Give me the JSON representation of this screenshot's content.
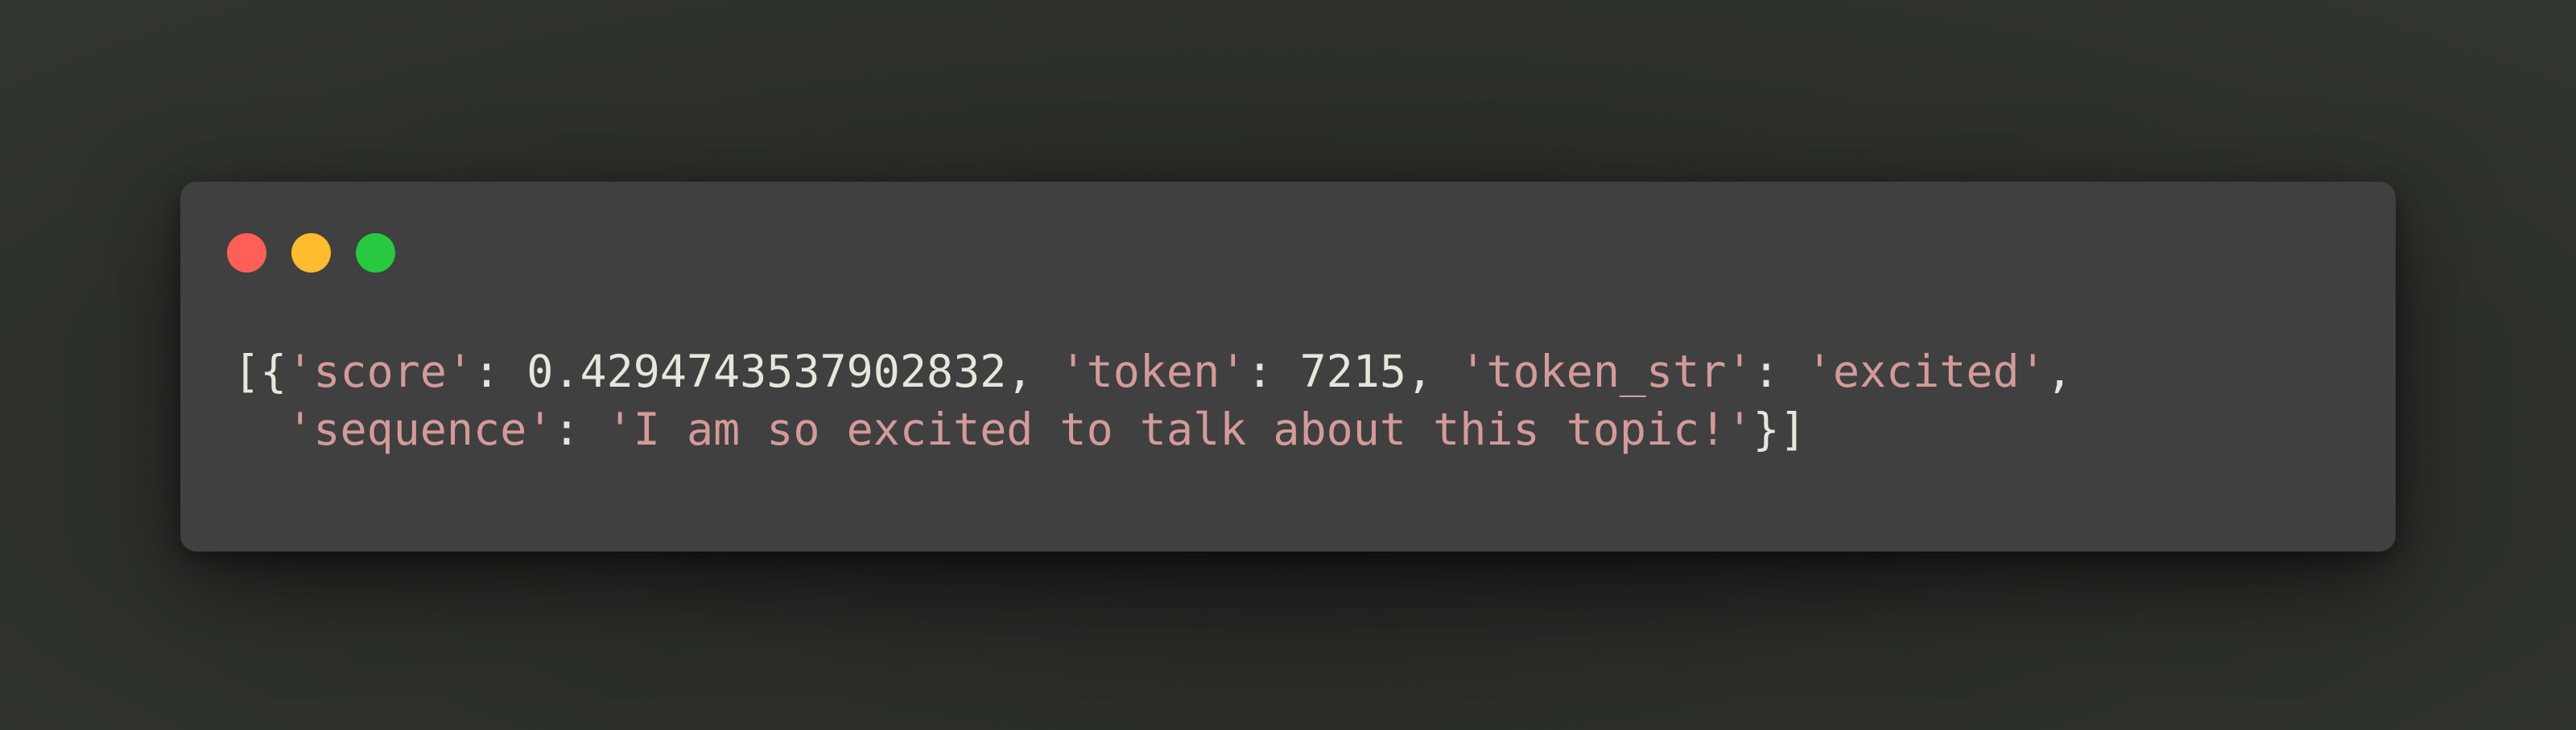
{
  "window": {
    "controls": [
      {
        "name": "close",
        "color": "#ff5f57"
      },
      {
        "name": "minimize",
        "color": "#febc2e"
      },
      {
        "name": "maximize",
        "color": "#28c840"
      }
    ]
  },
  "code": {
    "line1": [
      {
        "t": "[{",
        "k": "punct"
      },
      {
        "t": "'score'",
        "k": "str"
      },
      {
        "t": ": ",
        "k": "punct"
      },
      {
        "t": "0.4294743537902832",
        "k": "num"
      },
      {
        "t": ", ",
        "k": "punct"
      },
      {
        "t": "'token'",
        "k": "str"
      },
      {
        "t": ": ",
        "k": "punct"
      },
      {
        "t": "7215",
        "k": "num"
      },
      {
        "t": ", ",
        "k": "punct"
      },
      {
        "t": "'token_str'",
        "k": "str"
      },
      {
        "t": ": ",
        "k": "punct"
      },
      {
        "t": "'excited'",
        "k": "str"
      },
      {
        "t": ",",
        "k": "punct"
      }
    ],
    "line2": [
      {
        "t": "  ",
        "k": "punct"
      },
      {
        "t": "'sequence'",
        "k": "str"
      },
      {
        "t": ": ",
        "k": "punct"
      },
      {
        "t": "'I am so excited to talk about this topic!'",
        "k": "str"
      },
      {
        "t": "}]",
        "k": "punct"
      }
    ]
  }
}
